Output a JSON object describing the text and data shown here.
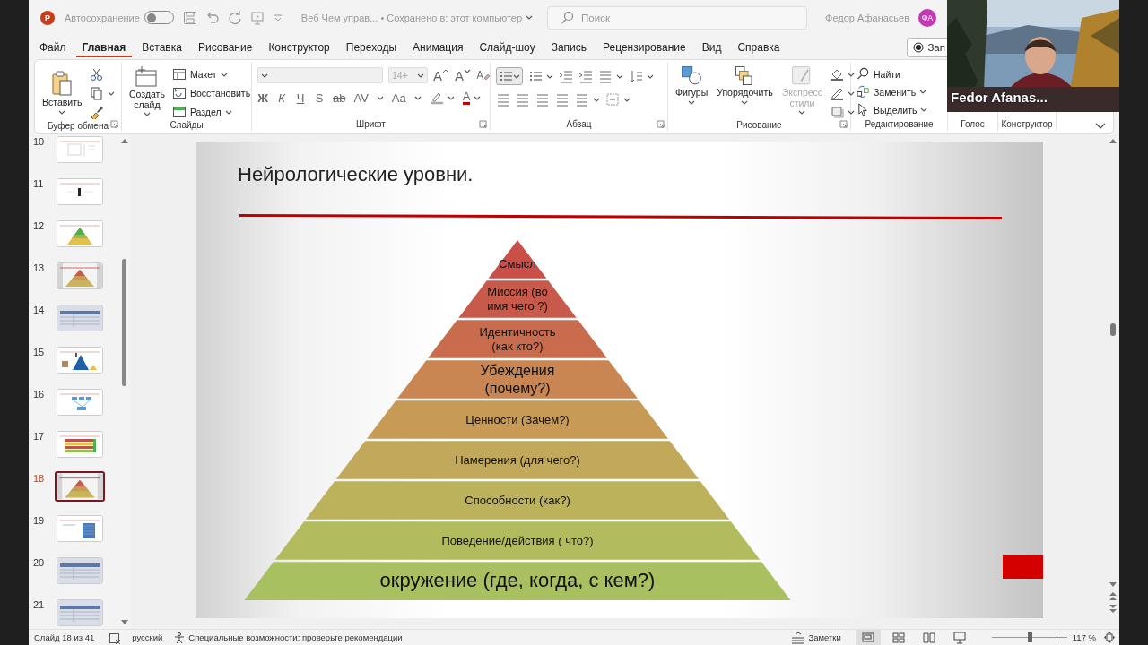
{
  "title_bar": {
    "app_logo": "P",
    "autosave_label": "Автосохранение",
    "autosave_on": false,
    "document_title": "Веб Чем управ... • Сохранено в: этот компьютер",
    "search_placeholder": "Поиск",
    "user_name": "Федор Афанасьев",
    "user_initials": "ФА"
  },
  "menu_tabs": [
    {
      "label": "Файл",
      "selected": false
    },
    {
      "label": "Главная",
      "selected": true
    },
    {
      "label": "Вставка",
      "selected": false
    },
    {
      "label": "Рисование",
      "selected": false
    },
    {
      "label": "Конструктор",
      "selected": false
    },
    {
      "label": "Переходы",
      "selected": false
    },
    {
      "label": "Анимация",
      "selected": false
    },
    {
      "label": "Слайд-шоу",
      "selected": false
    },
    {
      "label": "Запись",
      "selected": false
    },
    {
      "label": "Рецензирование",
      "selected": false
    },
    {
      "label": "Вид",
      "selected": false
    },
    {
      "label": "Справка",
      "selected": false
    }
  ],
  "record_button": "Зап",
  "ribbon": {
    "groups": [
      {
        "kind": "clipboard",
        "label": "Буфер обмена",
        "launcher": true,
        "paste_label": "Вставить"
      },
      {
        "kind": "slides",
        "label": "Слайды",
        "launcher": false,
        "new_slide_label": "Создать\nслайд",
        "buttons": [
          "Макет",
          "Восстановить",
          "Раздел"
        ]
      },
      {
        "kind": "font",
        "label": "Шрифт",
        "launcher": true,
        "size": "14+",
        "size_buttons": [
          "A",
          "A"
        ],
        "format_buttons": [
          "Ж",
          "К",
          "Ч",
          "S",
          "ab",
          "AV",
          "Aa"
        ],
        "color_button": "A"
      },
      {
        "kind": "paragraph",
        "label": "Абзац",
        "launcher": true
      },
      {
        "kind": "drawing",
        "label": "Рисование",
        "launcher": true,
        "buttons": [
          {
            "label": "Фигуры",
            "disabled": false
          },
          {
            "label": "Упорядочить",
            "disabled": false
          },
          {
            "label": "Экспресс\nстили",
            "disabled": true
          }
        ]
      },
      {
        "kind": "editing",
        "label": "Редактирование",
        "launcher": false,
        "buttons": [
          "Найти",
          "Заменить",
          "Выделить"
        ]
      },
      {
        "kind": "voice",
        "label": "Голос",
        "launcher": false
      },
      {
        "kind": "designer",
        "label": "Конструктор",
        "launcher": false
      }
    ]
  },
  "slides_panel": {
    "slides": [
      {
        "number": "10",
        "kind": "sketch",
        "selected": false
      },
      {
        "number": "11",
        "kind": "figure",
        "selected": false
      },
      {
        "number": "12",
        "kind": "pyramid",
        "selected": false
      },
      {
        "number": "13",
        "kind": "shaded-pyramid",
        "selected": false
      },
      {
        "number": "14",
        "kind": "table",
        "selected": false
      },
      {
        "number": "15",
        "kind": "triangle",
        "selected": false
      },
      {
        "number": "16",
        "kind": "flow",
        "selected": false
      },
      {
        "number": "17",
        "kind": "bars",
        "selected": false
      },
      {
        "number": "18",
        "kind": "shaded-pyramid",
        "selected": true
      },
      {
        "number": "19",
        "kind": "list",
        "selected": false
      },
      {
        "number": "20",
        "kind": "table",
        "selected": false
      },
      {
        "number": "21",
        "kind": "table",
        "selected": false
      }
    ]
  },
  "slide": {
    "title": "Нейрологические уровни.",
    "levels": [
      {
        "text": "Смысл",
        "color": "#c94f48",
        "kind": "small"
      },
      {
        "text": "Миссия (во\nимя чего ?)",
        "color": "#c85a4b",
        "kind": "small"
      },
      {
        "text": "Идентичность\n(как кто?)",
        "color": "#c96c4e",
        "kind": "small"
      },
      {
        "text": "Убеждения\n(почему?)",
        "color": "#c98552",
        "kind": "medium"
      },
      {
        "text": "Ценности (Зачем?)",
        "color": "#c79a56",
        "kind": "small"
      },
      {
        "text": "Намерения (для чего?)",
        "color": "#c2a85a",
        "kind": "small"
      },
      {
        "text": "Способности (как?)",
        "color": "#bcb25c",
        "kind": "small"
      },
      {
        "text": "Поведение/действия ( что?)",
        "color": "#b2bb5e",
        "kind": "small"
      },
      {
        "text": "окружение (где, когда, с кем?)",
        "color": "#a8c05f",
        "kind": "large"
      }
    ]
  },
  "status_bar": {
    "slide_counter": "Слайд 18 из 41",
    "language": "русский",
    "accessibility": "Специальные возможности: проверьте рекомендации",
    "notes": "Заметки",
    "views": [
      {
        "kind": "normal",
        "selected": true
      },
      {
        "kind": "sorter",
        "selected": false
      },
      {
        "kind": "reading",
        "selected": false
      },
      {
        "kind": "show",
        "selected": false
      }
    ],
    "zoom": {
      "level": 0.5,
      "reading": "117 %"
    }
  },
  "video_overlay": {
    "participant_name": "Fedor Afanas..."
  }
}
